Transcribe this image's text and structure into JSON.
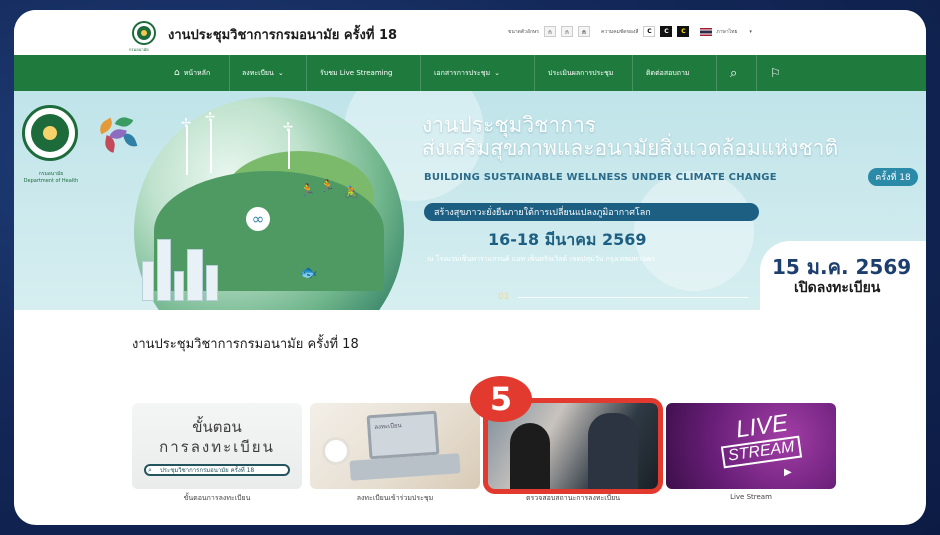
{
  "header": {
    "site_title": "งานประชุมวิชาการกรมอนามัย ครั้งที่ 18",
    "logo_caption": "กรมอนามัย",
    "font_size_label": "ขนาดตัวอักษร",
    "font_size_buttons": [
      "ก",
      "ก",
      "ก"
    ],
    "contrast_label": "ความคมชัดของสี",
    "contrast_buttons": [
      "C",
      "C",
      "C"
    ],
    "language": "ภาษาไทย"
  },
  "nav": {
    "items": [
      {
        "icon": "home-icon",
        "label": "หน้าหลัก"
      },
      {
        "label": "ลงทะเบียน",
        "has_dropdown": true
      },
      {
        "label": "รับชม Live Streaming"
      },
      {
        "label": "เอกสารการประชุม",
        "has_dropdown": true
      },
      {
        "label": "ประเมินผลการประชุม"
      },
      {
        "label": "ติดต่อสอบถาม"
      }
    ]
  },
  "hero": {
    "logo_caption_line1": "กรมอนามัย",
    "logo_caption_line2": "Department of Health",
    "title_line1": "งานประชุมวิชาการ",
    "title_line2": "ส่งเสริมสุขภาพและอนามัยสิ่งแวดล้อมแห่งชาติ",
    "english_theme": "BUILDING SUSTAINABLE WELLNESS UNDER CLIMATE CHANGE",
    "edition": "ครั้งที่ 18",
    "subtitle": "สร้างสุขภาวะยั่งยืนภายใต้การเปลี่ยนแปลงภูมิอากาศโลก",
    "date": "16-18 มีนาคม 2569",
    "venue": "ณ โรงแรมเซ็นทาราแกรนด์ แอท เซ็นทรัลเวิลด์ เขตปทุมวัน กรุงเทพมหานคร",
    "registration_date": "15 ม.ค. 2569",
    "registration_text": "เปิดลงทะเบียน",
    "slide_number": "01"
  },
  "section": {
    "title": "งานประชุมวิชาการกรมอนามัย ครั้งที่ 18"
  },
  "cards": [
    {
      "label": "ขั้นตอนการลงทะเบียน",
      "thumb_line1": "ขั้นตอน",
      "thumb_line2": "การลงทะเบียน",
      "thumb_search": "ประชุมวิชาการกรมอนามัย ครั้งที่ 18"
    },
    {
      "label": "ลงทะเบียนเข้าร่วมประชุม",
      "thumb_screen": "ลงทะเบียน"
    },
    {
      "label": "ตรวจสอบสถานะการลงทะเบียน"
    },
    {
      "label": "Live Stream",
      "thumb_live": "LIVE",
      "thumb_stream": "STREAM"
    }
  ],
  "annotation": {
    "step_number": "5",
    "color": "#e23a2e"
  },
  "colors": {
    "nav_green": "#1f7a3e",
    "hero_blue": "#1d5f82",
    "frame_bg": "#14295a"
  }
}
